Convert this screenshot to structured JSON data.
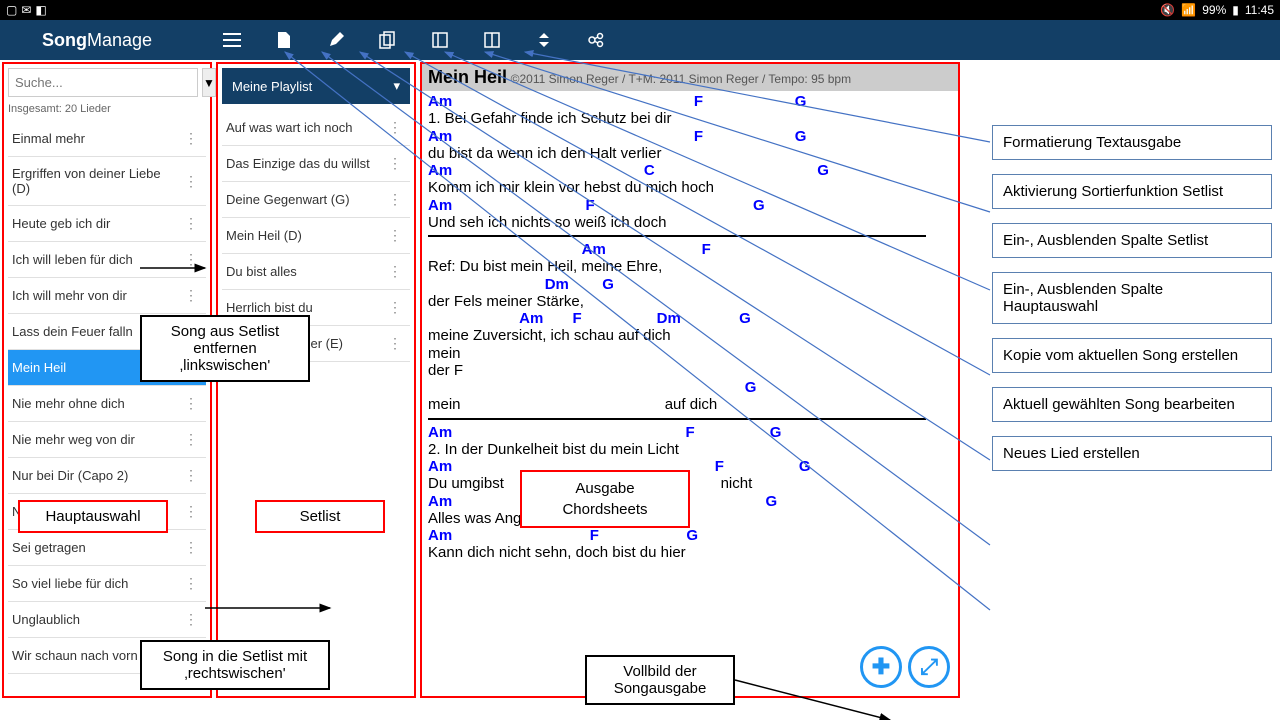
{
  "status": {
    "battery": "99%",
    "time": "11:45"
  },
  "app": {
    "title1": "Song",
    "title2": "Manage"
  },
  "search": {
    "placeholder": "Suche..."
  },
  "total": "Insgesamt: 20 Lieder",
  "songs": [
    "Einmal mehr",
    "Ergriffen von deiner Liebe (D)",
    "Heute geb ich dir",
    "Ich will leben für dich",
    "Ich will mehr von dir",
    "Lass dein Feuer falln",
    "Mein Heil",
    "Nie mehr ohne dich",
    "Nie mehr weg von dir",
    "Nur bei Dir (Capo 2)",
    "Nur du bist mein Licht",
    "Sei getragen",
    "So viel liebe für dich",
    "Unglaublich",
    "Wir schaun nach vorn"
  ],
  "selected": "Mein Heil",
  "playlist": {
    "name": "Meine Playlist",
    "items": [
      "Auf was wart ich noch",
      "Das Einzige das du willst",
      "Deine Gegenwart (G)",
      "Mein Heil (D)",
      "Du bist alles",
      "Herrlich bist du",
      "Komm mit Feuer (E)"
    ]
  },
  "song": {
    "title": "Mein Heil",
    "meta": "©2011 Simon Reger / T+M: 2011 Simon Reger / Tempo: 95 bpm"
  },
  "lines": [
    {
      "c": "Am                                                          F                      G"
    },
    {
      "l": "1. Bei Gefahr finde ich Schutz bei dir"
    },
    {
      "c": "Am                                                          F                      G"
    },
    {
      "l": "du bist da wenn ich den Halt verlier"
    },
    {
      "c": "Am                                              C                                       G"
    },
    {
      "l": "Komm ich mir klein vor hebst du mich hoch"
    },
    {
      "c": "Am                                F                                      G"
    },
    {
      "l": "Und seh ich nichts so weiß ich doch"
    },
    {
      "sep": true
    },
    {
      "c": "                                     Am                       F"
    },
    {
      "l": "Ref: Du bist mein Heil, meine Ehre,"
    },
    {
      "c": "                            Dm        G"
    },
    {
      "l": "der Fels meiner Stärke,"
    },
    {
      "c": "                      Am       F                  Dm              G"
    },
    {
      "l": "meine Zuversicht, ich schau auf dich"
    },
    {
      "l": "mein"
    },
    {
      "l": "der F"
    },
    {
      "c": "                                                                            G"
    },
    {
      "l": "mein                                                 auf dich"
    },
    {
      "sep": true
    },
    {
      "c": "Am                                                        F                  G"
    },
    {
      "l": "2. In der Dunkelheit bist du mein Licht"
    },
    {
      "c": "Am                                                               F                  G"
    },
    {
      "l": "Du umgibst                                                    nicht"
    },
    {
      "c": "Am                      F                                                   G"
    },
    {
      "l": "Alles was Angst macht, fällt ab von mir"
    },
    {
      "c": "Am                                 F                     G"
    },
    {
      "l": "Kann dich nicht sehn, doch bist du hier"
    }
  ],
  "annos": {
    "right": [
      "Formatierung Textausgabe",
      "Aktivierung Sortierfunktion Setlist",
      "Ein-, Ausblenden Spalte Setlist",
      "Ein-, Ausblenden Spalte Hauptauswahl",
      "Kopie vom aktuellen Song erstellen",
      "Aktuell gewählten Song bearbeiten",
      "Neues Lied erstellen"
    ],
    "haupt": "Hauptauswahl",
    "setlist": "Setlist",
    "chord": "Ausgabe Chordsheets",
    "voll": "Vollbild der Songausgabe",
    "remove": "Song aus Setlist entfernen ‚linkswischen'",
    "add": "Song in die Setlist mit ‚rechtswischen'"
  }
}
